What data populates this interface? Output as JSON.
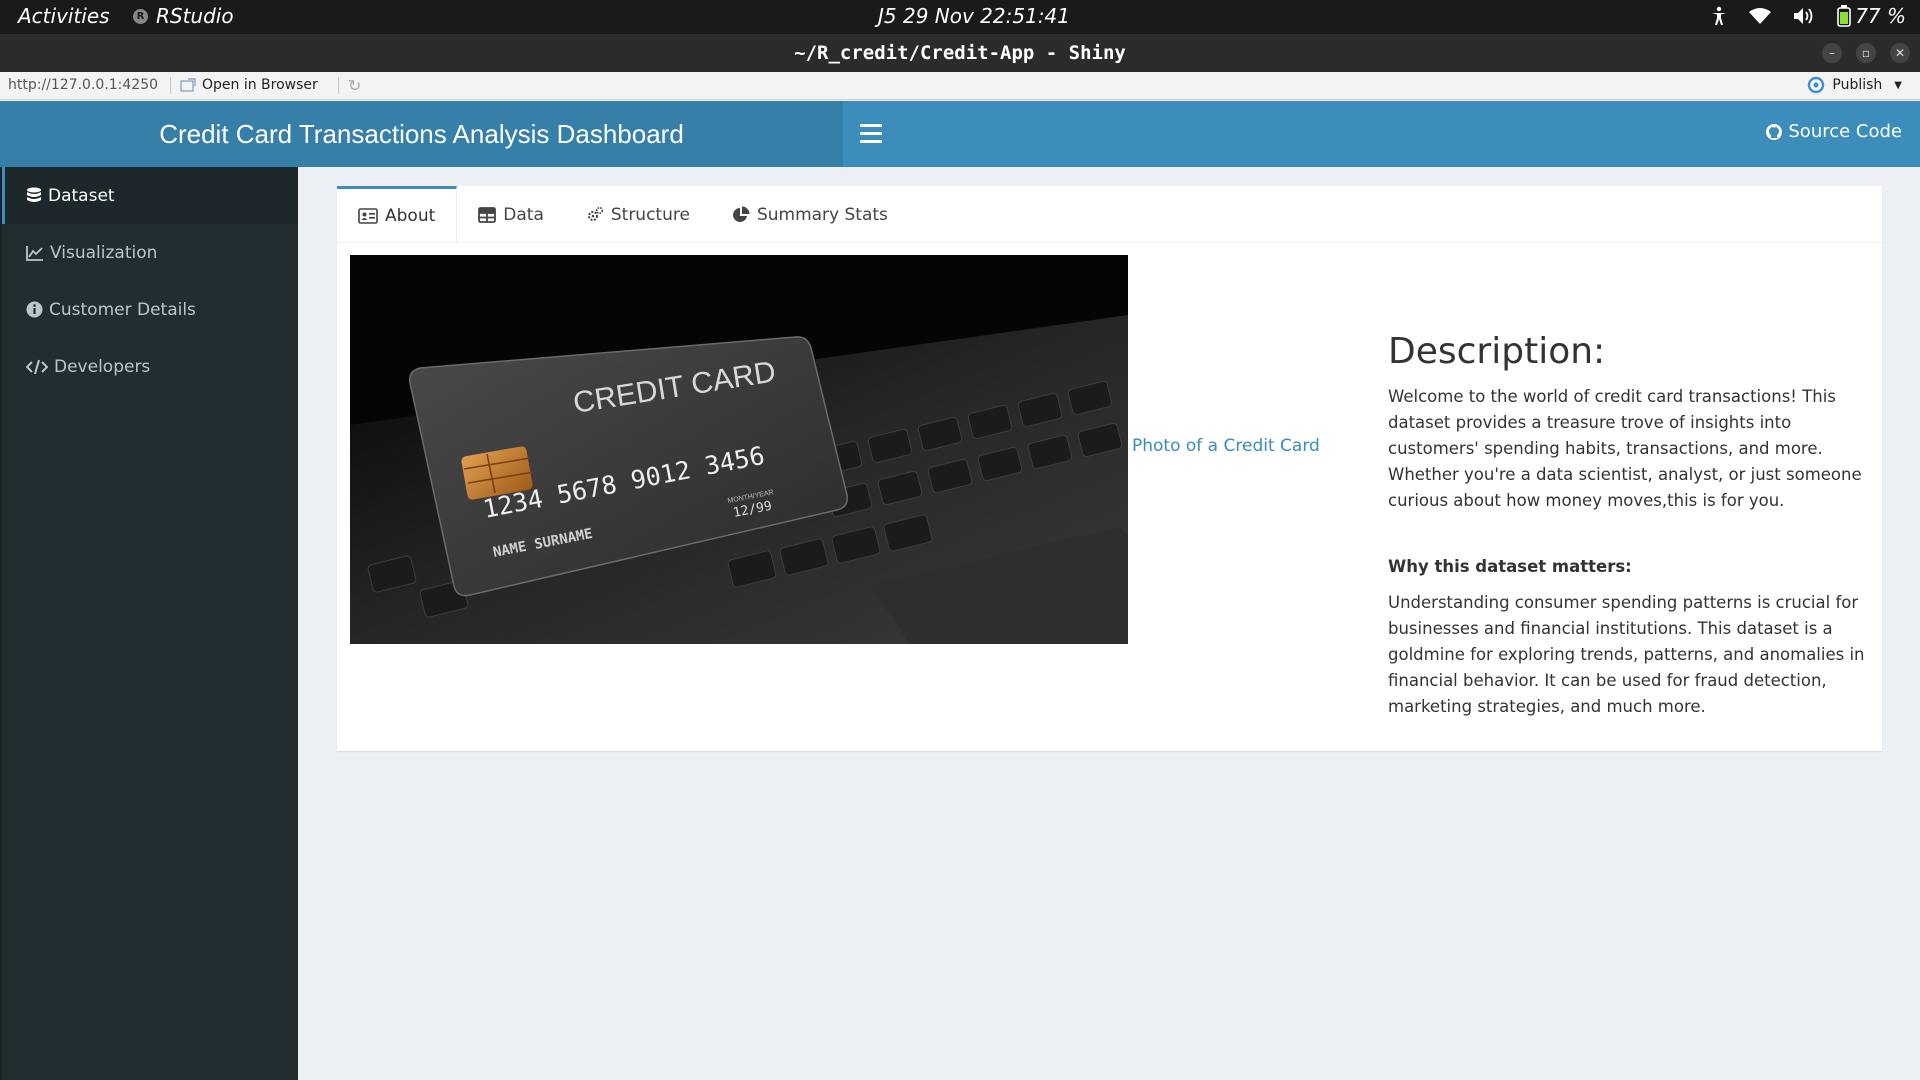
{
  "system_bar": {
    "activities": "Activities",
    "app_name": "RStudio",
    "clock": "J5 29 Nov  22:51:41",
    "battery": "77 %"
  },
  "window": {
    "title": "~/R_credit/Credit-App - Shiny"
  },
  "viewer_toolbar": {
    "url": "http://127.0.0.1:4250",
    "open_in_browser": "Open in Browser",
    "publish": "Publish"
  },
  "header": {
    "title": "Credit Card Transactions Analysis Dashboard",
    "source_code": "Source Code",
    "color": "#3c8dbc"
  },
  "sidebar": {
    "items": [
      {
        "label": "Dataset",
        "icon": "database-icon",
        "active": true
      },
      {
        "label": "Visualization",
        "icon": "line-chart-icon",
        "active": false
      },
      {
        "label": "Customer Details",
        "icon": "info-circle-icon",
        "active": false
      },
      {
        "label": "Developers",
        "icon": "code-icon",
        "active": false
      }
    ]
  },
  "tabs": [
    {
      "label": "About",
      "icon": "id-card-icon",
      "active": true
    },
    {
      "label": "Data",
      "icon": "table-icon",
      "active": false
    },
    {
      "label": "Structure",
      "icon": "cogs-icon",
      "active": false
    },
    {
      "label": "Summary Stats",
      "icon": "pie-chart-icon",
      "active": false
    }
  ],
  "about": {
    "image_card": {
      "title": "CREDIT CARD",
      "number": "1234  5678  9012  3456",
      "valid_label": "MONTH/YEAR",
      "expiry": "12/99",
      "name": "NAME  SURNAME"
    },
    "photo_link": "Photo of a Credit Card",
    "heading": "Description:",
    "intro": "Welcome to the world of credit card transactions! This dataset provides a treasure trove of insights into customers' spending habits, transactions, and more. Whether you're a data scientist, analyst, or just someone curious about how money moves,this is for you.",
    "why_heading": "Why this dataset matters:",
    "why_text": "Understanding consumer spending patterns is crucial for businesses and financial institutions. This dataset is a goldmine for exploring trends, patterns, and anomalies in financial behavior. It can be used for fraud detection, marketing strategies, and much more."
  }
}
